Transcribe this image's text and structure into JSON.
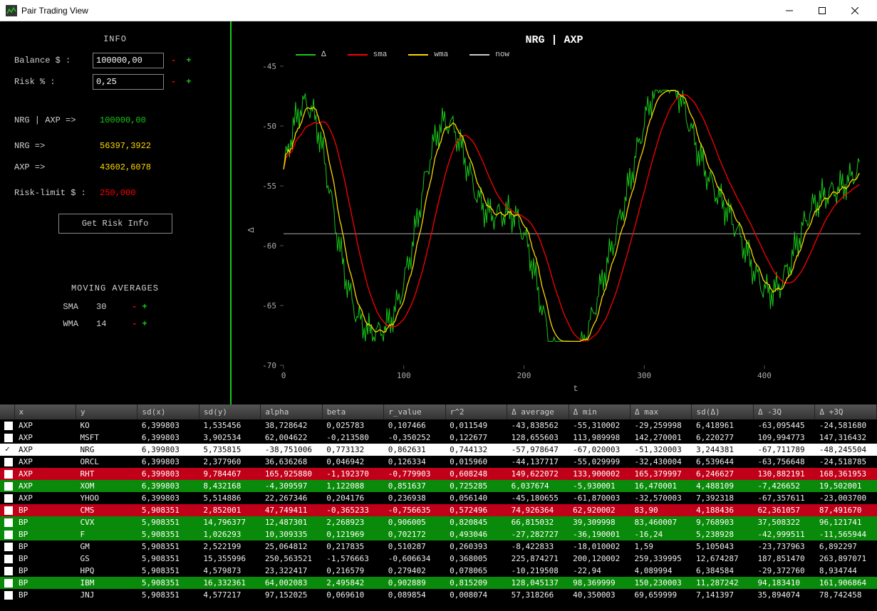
{
  "window": {
    "title": "Pair Trading View"
  },
  "sidebar": {
    "info_title": "INFO",
    "balance_label": "Balance $ :",
    "balance_value": "100000,00",
    "risk_label": "Risk % :",
    "risk_value": "0,25",
    "pair_label": "NRG | AXP =>",
    "pair_value": "100000,00",
    "sym1_label": "NRG =>",
    "sym1_value": "56397,3922",
    "sym2_label": "AXP =>",
    "sym2_value": "43602,6078",
    "risklimit_label": "Risk-limit $ :",
    "risklimit_value": "250,000",
    "button": "Get Risk Info",
    "ma_title": "MOVING AVERAGES",
    "sma_label": "SMA",
    "sma_value": "30",
    "wma_label": "WMA",
    "wma_value": "14",
    "minus": "-",
    "plus": "+"
  },
  "chart_data": {
    "type": "line",
    "title": "NRG | AXP",
    "xlabel": "t",
    "ylabel": "Δ",
    "xlim": [
      0,
      480
    ],
    "ylim": [
      -70,
      -45
    ],
    "y_ticks": [
      -70,
      -65,
      -60,
      -55,
      -50,
      -45
    ],
    "x_ticks": [
      0,
      100,
      200,
      300,
      400
    ],
    "now_line": -59,
    "series": [
      {
        "name": "Δ",
        "color": "#18c81a"
      },
      {
        "name": "sma",
        "color": "#f00"
      },
      {
        "name": "wma",
        "color": "#ffd800"
      },
      {
        "name": "now",
        "color": "#ccc"
      }
    ]
  },
  "legend": {
    "delta": "Δ",
    "sma": "sma",
    "wma": "wma",
    "now": "now"
  },
  "table": {
    "headers": [
      "",
      "x",
      "y",
      "sd(x)",
      "sd(y)",
      "alpha",
      "beta",
      "r_value",
      "r^2",
      "Δ average",
      "Δ min",
      "Δ max",
      "sd(Δ)",
      "Δ -3Q",
      "Δ +3Q"
    ],
    "rows": [
      {
        "c": false,
        "cls": "row-default",
        "cells": [
          "AXP",
          "KO",
          "6,399803",
          "1,535456",
          "38,728642",
          "0,025783",
          "0,107466",
          "0,011549",
          "-43,838562",
          "-55,310002",
          "-29,259998",
          "6,418961",
          "-63,095445",
          "-24,581680"
        ]
      },
      {
        "c": false,
        "cls": "row-default",
        "cells": [
          "AXP",
          "MSFT",
          "6,399803",
          "3,902534",
          "62,004622",
          "-0,213580",
          "-0,350252",
          "0,122677",
          "128,655603",
          "113,989998",
          "142,270001",
          "6,220277",
          "109,994773",
          "147,316432"
        ]
      },
      {
        "c": true,
        "cls": "row-selected",
        "cells": [
          "AXP",
          "NRG",
          "6,399803",
          "5,735815",
          "-38,751006",
          "0,773132",
          "0,862631",
          "0,744132",
          "-57,978647",
          "-67,020003",
          "-51,320003",
          "3,244381",
          "-67,711789",
          "-48,245504"
        ]
      },
      {
        "c": false,
        "cls": "row-default",
        "cells": [
          "AXP",
          "ORCL",
          "6,399803",
          "2,377960",
          "36,636268",
          "0,046942",
          "0,126334",
          "0,015960",
          "-44,137717",
          "-55,029999",
          "-32,430004",
          "6,539644",
          "-63,756648",
          "-24,518785"
        ]
      },
      {
        "c": false,
        "cls": "row-red",
        "cells": [
          "AXP",
          "RHT",
          "6,399803",
          "9,784467",
          "165,925880",
          "-1,192370",
          "-0,779903",
          "0,608248",
          "149,622072",
          "133,900002",
          "165,379997",
          "6,246627",
          "130,882191",
          "168,361953"
        ]
      },
      {
        "c": false,
        "cls": "row-green",
        "cells": [
          "AXP",
          "XOM",
          "6,399803",
          "8,432168",
          "-4,309597",
          "1,122088",
          "0,851637",
          "0,725285",
          "6,037674",
          "-5,930001",
          "16,470001",
          "4,488109",
          "-7,426652",
          "19,502001"
        ]
      },
      {
        "c": false,
        "cls": "row-default",
        "cells": [
          "AXP",
          "YHOO",
          "6,399803",
          "5,514886",
          "22,267346",
          "0,204176",
          "0,236938",
          "0,056140",
          "-45,180655",
          "-61,870003",
          "-32,570003",
          "7,392318",
          "-67,357611",
          "-23,003700"
        ]
      },
      {
        "c": false,
        "cls": "row-red",
        "cells": [
          "BP",
          "CMS",
          "5,908351",
          "2,852001",
          "47,749411",
          "-0,365233",
          "-0,756635",
          "0,572496",
          "74,926364",
          "62,920002",
          "83,90",
          "4,188436",
          "62,361057",
          "87,491670"
        ]
      },
      {
        "c": false,
        "cls": "row-green",
        "cells": [
          "BP",
          "CVX",
          "5,908351",
          "14,796377",
          "12,487301",
          "2,268923",
          "0,906005",
          "0,820845",
          "66,815032",
          "39,309998",
          "83,460007",
          "9,768903",
          "37,508322",
          "96,121741"
        ]
      },
      {
        "c": false,
        "cls": "row-green",
        "cells": [
          "BP",
          "F",
          "5,908351",
          "1,026293",
          "10,309335",
          "0,121969",
          "0,702172",
          "0,493046",
          "-27,282727",
          "-36,190001",
          "-16,24",
          "5,238928",
          "-42,999511",
          "-11,565944"
        ]
      },
      {
        "c": false,
        "cls": "row-default",
        "cells": [
          "BP",
          "GM",
          "5,908351",
          "2,522199",
          "25,064812",
          "0,217835",
          "0,510287",
          "0,260393",
          "-8,422833",
          "-18,010002",
          "1,59",
          "5,105043",
          "-23,737963",
          "6,892297"
        ]
      },
      {
        "c": false,
        "cls": "row-default",
        "cells": [
          "BP",
          "GS",
          "5,908351",
          "15,355996",
          "250,563521",
          "-1,576663",
          "-0,606634",
          "0,368005",
          "225,874271",
          "200,120002",
          "259,339995",
          "12,674287",
          "187,851470",
          "263,897071"
        ]
      },
      {
        "c": false,
        "cls": "row-default",
        "cells": [
          "BP",
          "HPQ",
          "5,908351",
          "4,579873",
          "23,322417",
          "0,216579",
          "0,279402",
          "0,078065",
          "-10,219508",
          "-22,94",
          "4,089994",
          "6,384584",
          "-29,372760",
          "8,934744"
        ]
      },
      {
        "c": false,
        "cls": "row-green",
        "cells": [
          "BP",
          "IBM",
          "5,908351",
          "16,332361",
          "64,002083",
          "2,495842",
          "0,902889",
          "0,815209",
          "128,045137",
          "98,369999",
          "150,230003",
          "11,287242",
          "94,183410",
          "161,906864"
        ]
      },
      {
        "c": false,
        "cls": "row-default",
        "cells": [
          "BP",
          "JNJ",
          "5,908351",
          "4,577217",
          "97,152025",
          "0,069610",
          "0,089854",
          "0,008074",
          "57,318266",
          "40,350003",
          "69,659999",
          "7,141397",
          "35,894074",
          "78,742458"
        ]
      }
    ]
  }
}
